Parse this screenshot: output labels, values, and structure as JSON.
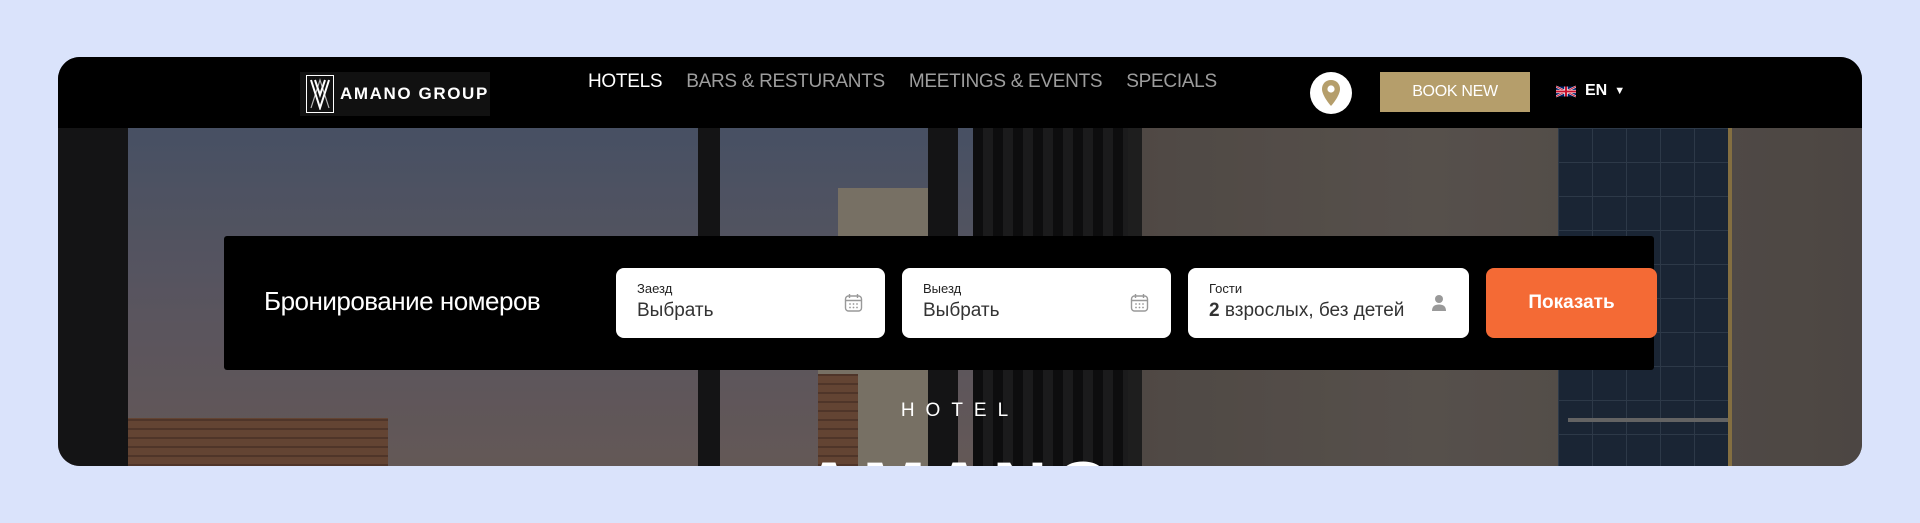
{
  "header": {
    "logo_text": "AMANO GROUP",
    "nav": [
      {
        "label": "HOTELS",
        "active": true
      },
      {
        "label": "BARS & RESTURANTS",
        "active": false
      },
      {
        "label": "MEETINGS & EVENTS",
        "active": false
      },
      {
        "label": "SPECIALS",
        "active": false
      }
    ],
    "book_label": "BOOK NEW",
    "language": "EN"
  },
  "booking": {
    "title": "Бронирование номеров",
    "checkin": {
      "label": "Заезд",
      "value": "Выбрать"
    },
    "checkout": {
      "label": "Выезд",
      "value": "Выбрать"
    },
    "guests": {
      "label": "Гости",
      "count": "2",
      "value": "взрослых, без детей"
    },
    "submit_label": "Показать"
  },
  "hero": {
    "eyebrow": "HOTEL",
    "title": "AMANO"
  },
  "colors": {
    "page_bg": "#dae3fb",
    "accent_gold": "#b59e6b",
    "cta_orange": "#f46a35"
  },
  "icons": [
    "map-pin-icon",
    "uk-flag-icon",
    "caret-down-icon",
    "calendar-icon",
    "user-icon"
  ]
}
